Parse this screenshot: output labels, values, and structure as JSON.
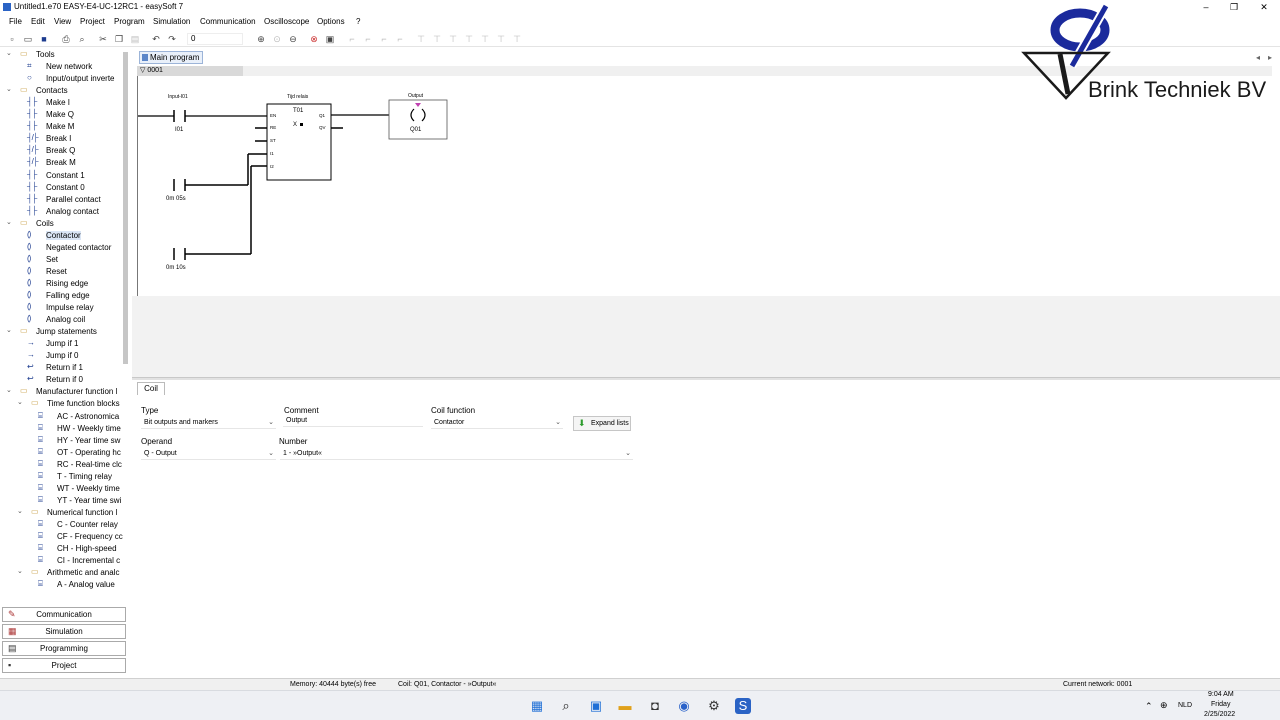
{
  "window": {
    "title": "Untitled1.e70 EASY-E4-UC-12RC1 - easySoft 7",
    "minimize": "–",
    "maximize": "❐",
    "close": "✕"
  },
  "menu": [
    "File",
    "Edit",
    "View",
    "Project",
    "Program",
    "Simulation",
    "Communication",
    "Oscilloscope",
    "Options",
    "?"
  ],
  "toolbar": {
    "zoom_value": "0"
  },
  "sidebar": {
    "tree": [
      {
        "label": "Tools",
        "type": "group"
      },
      {
        "label": "New network",
        "icon": "network-icon"
      },
      {
        "label": "Input/output inverte",
        "icon": "invert-icon"
      },
      {
        "label": "Contacts",
        "type": "group"
      },
      {
        "label": "Make I",
        "icon": "make-contact-icon"
      },
      {
        "label": "Make Q",
        "icon": "make-contact-icon"
      },
      {
        "label": "Make M",
        "icon": "make-contact-icon"
      },
      {
        "label": "Break I",
        "icon": "break-contact-icon"
      },
      {
        "label": "Break Q",
        "icon": "break-contact-icon"
      },
      {
        "label": "Break M",
        "icon": "break-contact-icon"
      },
      {
        "label": "Constant 1",
        "icon": "make-contact-icon"
      },
      {
        "label": "Constant 0",
        "icon": "make-contact-icon"
      },
      {
        "label": "Parallel contact",
        "icon": "make-contact-icon"
      },
      {
        "label": "Analog contact",
        "icon": "make-contact-icon"
      },
      {
        "label": "Coils",
        "type": "group"
      },
      {
        "label": "Contactor",
        "icon": "coil-icon",
        "selected": true
      },
      {
        "label": "Negated contactor",
        "icon": "coil-icon"
      },
      {
        "label": "Set",
        "icon": "coil-icon"
      },
      {
        "label": "Reset",
        "icon": "coil-icon"
      },
      {
        "label": "Rising edge",
        "icon": "coil-icon"
      },
      {
        "label": "Falling edge",
        "icon": "coil-icon"
      },
      {
        "label": "Impulse relay",
        "icon": "coil-icon"
      },
      {
        "label": "Analog coil",
        "icon": "coil-icon"
      },
      {
        "label": "Jump statements",
        "type": "group"
      },
      {
        "label": "Jump if 1",
        "icon": "jump-icon"
      },
      {
        "label": "Jump if 0",
        "icon": "jump-icon"
      },
      {
        "label": "Return if 1",
        "icon": "return-icon"
      },
      {
        "label": "Return if 0",
        "icon": "return-icon"
      },
      {
        "label": "Manufacturer function l",
        "type": "group"
      },
      {
        "label": "Time function blocks",
        "type": "subgroup"
      },
      {
        "label": "AC - Astronomica",
        "icon": "fb-icon"
      },
      {
        "label": "HW - Weekly time",
        "icon": "fb-icon"
      },
      {
        "label": "HY - Year time sw",
        "icon": "fb-icon"
      },
      {
        "label": "OT - Operating hc",
        "icon": "fb-icon"
      },
      {
        "label": "RC - Real-time clc",
        "icon": "fb-icon"
      },
      {
        "label": "T - Timing relay",
        "icon": "fb-icon"
      },
      {
        "label": "WT - Weekly time",
        "icon": "fb-icon"
      },
      {
        "label": "YT - Year time swi",
        "icon": "fb-icon"
      },
      {
        "label": "Numerical function l",
        "type": "subgroup"
      },
      {
        "label": "C - Counter relay",
        "icon": "fb-icon"
      },
      {
        "label": "CF - Frequency cc",
        "icon": "fb-icon"
      },
      {
        "label": "CH - High-speed",
        "icon": "fb-icon"
      },
      {
        "label": "CI - Incremental c",
        "icon": "fb-icon"
      },
      {
        "label": "Arithmetic and analc",
        "type": "subgroup"
      },
      {
        "label": "A - Analog value",
        "icon": "fb-icon"
      }
    ],
    "nav": [
      "Communication",
      "Simulation",
      "Programming",
      "Project"
    ]
  },
  "editor": {
    "tab": "Main program",
    "network_label": "0001",
    "diagram": {
      "input_label": "Input-I01",
      "input_operand": "I01",
      "timer_title": "Tijd relais",
      "timer_name": "T01",
      "timer_pins_left": [
        "EN",
        "RE",
        "ST",
        "I1",
        "I2"
      ],
      "timer_pins_right": [
        "Q1",
        "QV"
      ],
      "timer_mode": "X",
      "const1": "0m 05s",
      "const2": "0m 10s",
      "output_label": "Output",
      "output_operand": "Q01"
    }
  },
  "properties": {
    "tab": "Coil",
    "type_label": "Type",
    "type_value": "Bit outputs and markers",
    "comment_label": "Comment",
    "comment_value": "Output",
    "coil_function_label": "Coil function",
    "coil_function_value": "Contactor",
    "expand_button": "Expand lists",
    "operand_label": "Operand",
    "operand_value": "Q - Output",
    "number_label": "Number",
    "number_value": "1 - »Output«"
  },
  "status": {
    "memory": "Memory: 40444 byte(s) free",
    "selection": "Coil: Q01, Contactor - »Output«",
    "network": "Current network: 0001"
  },
  "taskbar": {
    "lang": "NLD",
    "time": "9:04 AM",
    "day": "Friday",
    "date": "2/25/2022"
  },
  "logo": {
    "text": "Brink Techniek BV"
  },
  "colors": {
    "accent": "#1d3c8f",
    "logo_blue": "#1b2a9c"
  }
}
